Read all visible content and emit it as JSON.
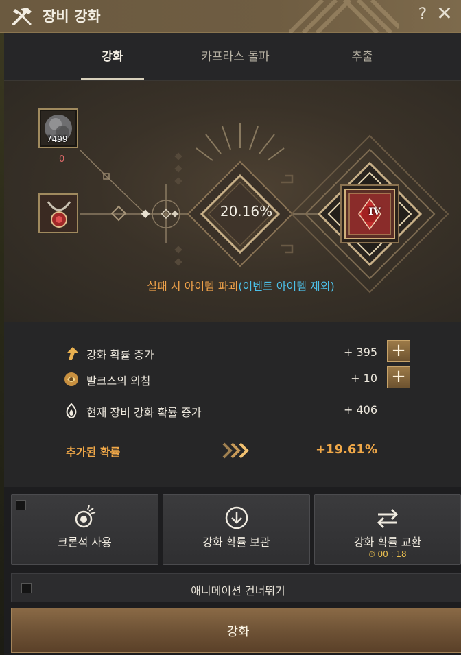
{
  "window": {
    "title": "장비 강화",
    "help_label": "?",
    "close_label": "✕"
  },
  "tabs": [
    {
      "label": "강화",
      "active": true
    },
    {
      "label": "카프라스 돌파",
      "active": false
    },
    {
      "label": "추출",
      "active": false
    }
  ],
  "enhance": {
    "material_count": "7499",
    "material_below": "0",
    "success_rate": "20.16%",
    "target_grade": "IV",
    "warning_main": "실패 시 아이템 파괴",
    "warning_note": "(이벤트 아이템 제외)"
  },
  "stats": [
    {
      "icon": "arrow-up-icon",
      "label": "강화 확률 증가",
      "value": "+ 395"
    },
    {
      "icon": "valks-cry-icon",
      "label": "발크스의 외침",
      "value": "+ 10"
    },
    {
      "icon": "flame-icon",
      "label": "현재 장비 강화 확률 증가",
      "value": "+ 406"
    }
  ],
  "added": {
    "label": "추가된 확률",
    "value": "+19.61%"
  },
  "actions": {
    "cron_label": "크론석 사용",
    "store_label": "강화 확률 보관",
    "exchange_label": "강화 확률 교환",
    "exchange_timer": "00 : 18"
  },
  "skip_animation_label": "애니메이션 건너뛰기",
  "enhance_button_label": "강화",
  "colors": {
    "accent_orange": "#f0a848",
    "note_blue": "#4cc0e8",
    "count_red": "#e06a6a",
    "timer_gold": "#ecc050"
  }
}
